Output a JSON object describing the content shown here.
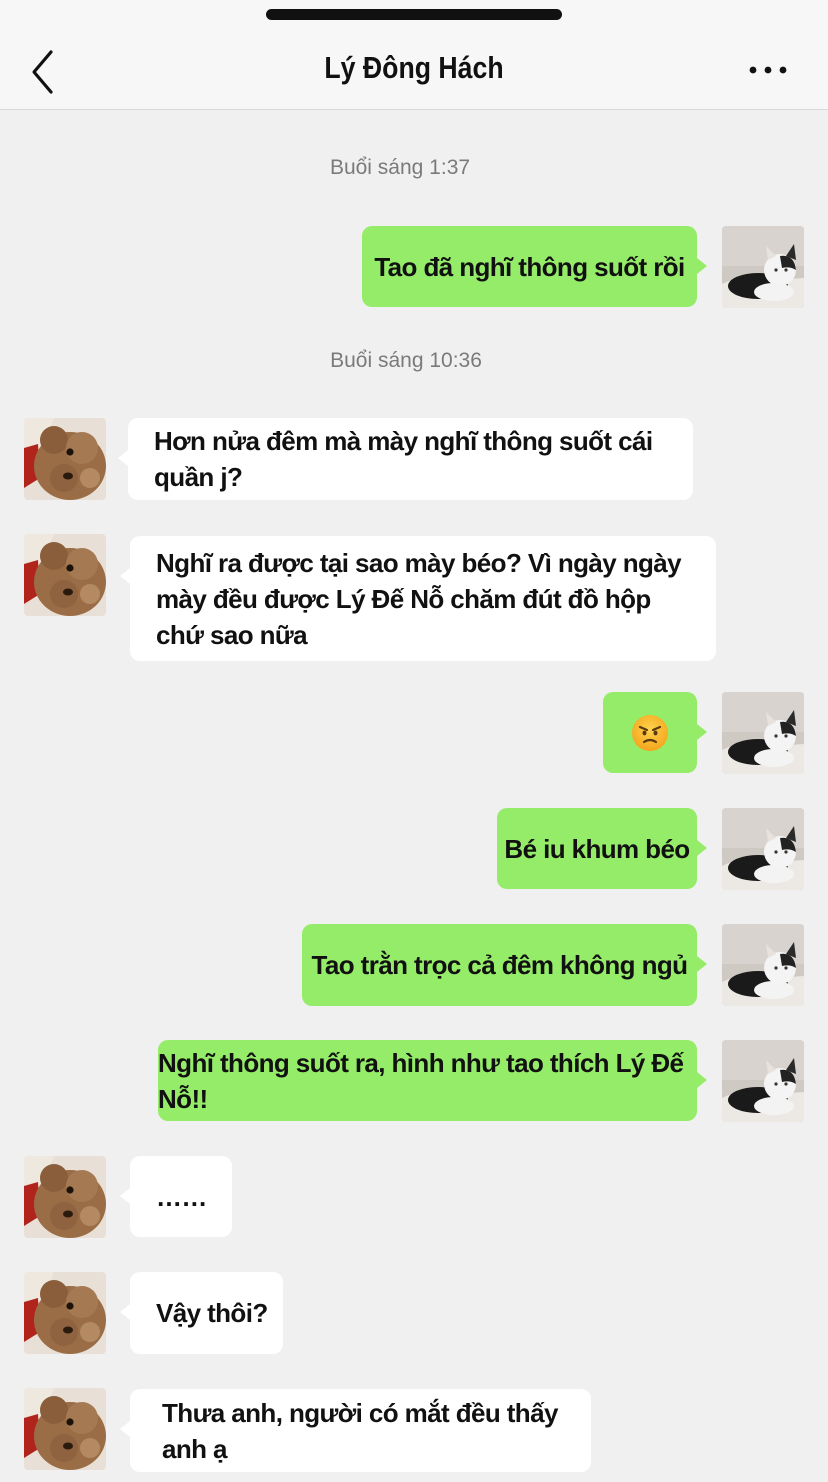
{
  "header": {
    "title": "Lý Đông Hách",
    "back_icon": "chevron-left-icon",
    "more_icon": "more-dots-icon"
  },
  "timestamps": [
    "Buổi sáng 1:37",
    "Buổi sáng 10:36"
  ],
  "messages": [
    {
      "side": "right",
      "text": "Tao đã nghĩ thông suốt rồi"
    },
    {
      "side": "left",
      "text": "Hơn nửa đêm mà mày nghĩ thông suốt cái quần j?"
    },
    {
      "side": "left",
      "text": "Nghĩ ra được tại sao mày béo? Vì ngày ngày mày đều được Lý Đế Nỗ chăm đút đồ hộp chứ sao nữa"
    },
    {
      "side": "right",
      "text": "",
      "emoji": "angry-face-emoji"
    },
    {
      "side": "right",
      "text": "Bé iu khum béo"
    },
    {
      "side": "right",
      "text": "Tao trằn trọc cả đêm không ngủ"
    },
    {
      "side": "right",
      "text": "Nghĩ thông suốt ra, hình như tao thích Lý Đế Nỗ!!"
    },
    {
      "side": "left",
      "text": "……"
    },
    {
      "side": "left",
      "text": "Vậy thôi?"
    },
    {
      "side": "left",
      "text": "Thưa anh, người có mắt đều thấy anh ạ"
    }
  ],
  "colors": {
    "background": "#f0f0f0",
    "sent_bubble": "#95ec69",
    "received_bubble": "#ffffff",
    "timestamp_text": "#7a7a7a"
  }
}
